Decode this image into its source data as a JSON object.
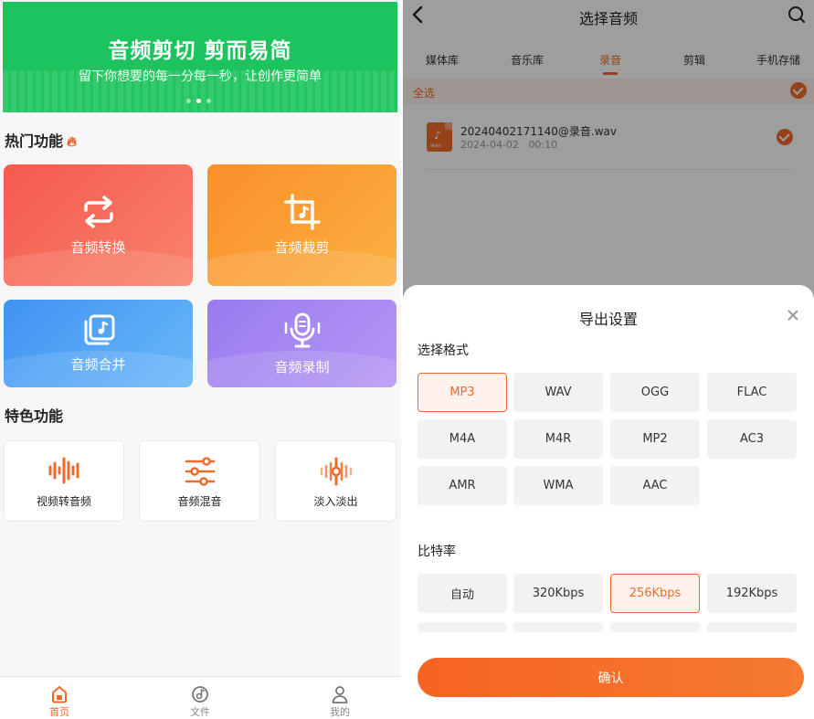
{
  "left": {
    "banner": {
      "title": "音频剪切 剪而易简",
      "subtitle": "留下你想要的每一分每一秒，让创作更简单",
      "dots": 3,
      "active_dot": 1
    },
    "hot_section": {
      "title": "热门功能"
    },
    "hot_items": [
      {
        "label": "音频转换",
        "icon": "convert-icon"
      },
      {
        "label": "音频裁剪",
        "icon": "crop-icon"
      },
      {
        "label": "音频合并",
        "icon": "merge-icon"
      },
      {
        "label": "音频录制",
        "icon": "microphone-icon"
      }
    ],
    "special_section": {
      "title": "特色功能"
    },
    "special_items": [
      {
        "label": "视频转音频",
        "icon": "waveform-icon"
      },
      {
        "label": "音频混音",
        "icon": "mixer-icon"
      },
      {
        "label": "淡入淡出",
        "icon": "fade-icon"
      }
    ],
    "bottom_nav": [
      {
        "label": "首页",
        "icon": "home-icon",
        "active": true
      },
      {
        "label": "文件",
        "icon": "file-icon",
        "active": false
      },
      {
        "label": "我的",
        "icon": "user-icon",
        "active": false
      }
    ]
  },
  "right": {
    "title": "选择音频",
    "tabs": [
      {
        "label": "媒体库",
        "active": false
      },
      {
        "label": "音乐库",
        "active": false
      },
      {
        "label": "录音",
        "active": true
      },
      {
        "label": "剪辑",
        "active": false
      },
      {
        "label": "手机存储",
        "active": false
      }
    ],
    "select_all": "全选",
    "file": {
      "name": "20240402171140@录音.wav",
      "date": "2024-04-02",
      "duration": "00:10",
      "selected": true
    },
    "sheet": {
      "title": "导出设置",
      "format_label": "选择格式",
      "formats": [
        "MP3",
        "WAV",
        "OGG",
        "FLAC",
        "M4A",
        "M4R",
        "MP2",
        "AC3",
        "AMR",
        "WMA",
        "AAC"
      ],
      "selected_format": "MP3",
      "bitrate_label": "比特率",
      "bitrates": [
        "自动",
        "320Kbps",
        "256Kbps",
        "192Kbps"
      ],
      "selected_bitrate": "256Kbps",
      "confirm": "确认"
    }
  },
  "colors": {
    "accent": "#f26a2b",
    "banner_green": "#1dc35c"
  }
}
